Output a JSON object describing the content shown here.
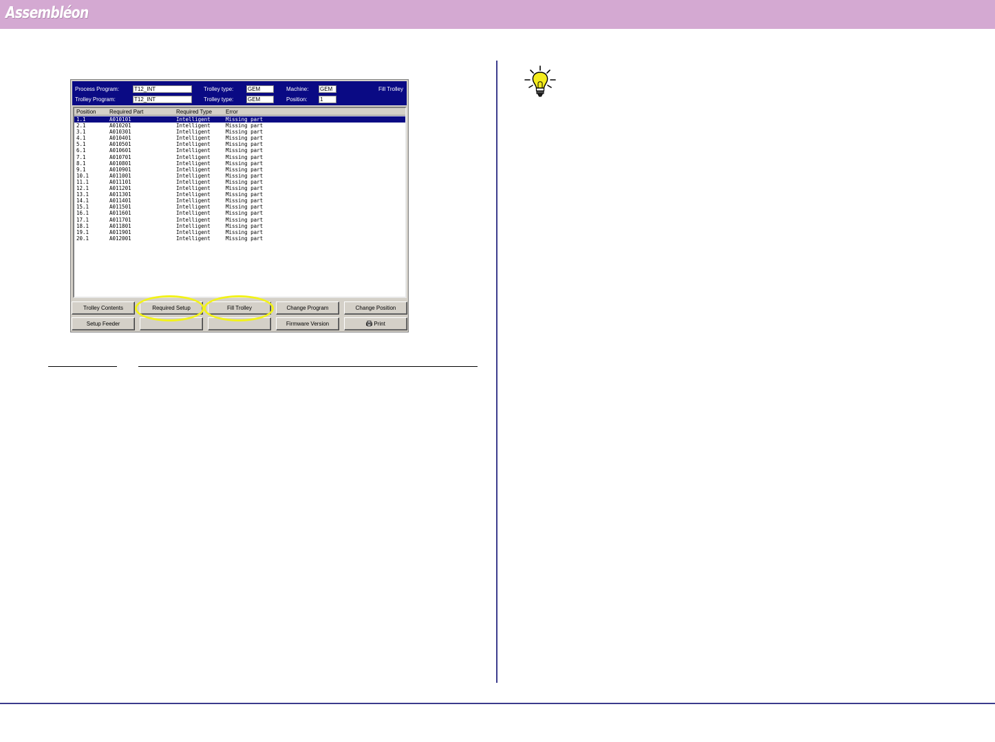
{
  "banner": {
    "logo": "Assembléon"
  },
  "window": {
    "header": {
      "process_program_label": "Process Program:",
      "process_program_value": "T12_INT",
      "trolley_program_label": "Trolley Program:",
      "trolley_program_value": "T12_INT",
      "trolley_type_label_1": "Trolley type:",
      "trolley_type_value_1": "GEM",
      "trolley_type_label_2": "Trolley type:",
      "trolley_type_value_2": "GEM",
      "machine_label": "Machine:",
      "machine_value": "GEM",
      "position_label": "Position:",
      "position_value": "1",
      "title": "Fill Trolley"
    },
    "columns": [
      "Position",
      "Required Part",
      "Required Type",
      "Error"
    ],
    "rows": [
      [
        "1.1",
        "A010101",
        "Intelligent",
        "Missing part"
      ],
      [
        "2.1",
        "A010201",
        "Intelligent",
        "Missing part"
      ],
      [
        "3.1",
        "A010301",
        "Intelligent",
        "Missing part"
      ],
      [
        "4.1",
        "A010401",
        "Intelligent",
        "Missing part"
      ],
      [
        "5.1",
        "A010501",
        "Intelligent",
        "Missing part"
      ],
      [
        "6.1",
        "A010601",
        "Intelligent",
        "Missing part"
      ],
      [
        "7.1",
        "A010701",
        "Intelligent",
        "Missing part"
      ],
      [
        "8.1",
        "A010801",
        "Intelligent",
        "Missing part"
      ],
      [
        "9.1",
        "A010901",
        "Intelligent",
        "Missing part"
      ],
      [
        "10.1",
        "A011001",
        "Intelligent",
        "Missing part"
      ],
      [
        "11.1",
        "A011101",
        "Intelligent",
        "Missing part"
      ],
      [
        "12.1",
        "A011201",
        "Intelligent",
        "Missing part"
      ],
      [
        "13.1",
        "A011301",
        "Intelligent",
        "Missing part"
      ],
      [
        "14.1",
        "A011401",
        "Intelligent",
        "Missing part"
      ],
      [
        "15.1",
        "A011501",
        "Intelligent",
        "Missing part"
      ],
      [
        "16.1",
        "A011601",
        "Intelligent",
        "Missing part"
      ],
      [
        "17.1",
        "A011701",
        "Intelligent",
        "Missing part"
      ],
      [
        "18.1",
        "A011801",
        "Intelligent",
        "Missing part"
      ],
      [
        "19.1",
        "A011901",
        "Intelligent",
        "Missing part"
      ],
      [
        "20.1",
        "A012001",
        "Intelligent",
        "Missing part"
      ]
    ],
    "selected_row": "1.1",
    "buttons": {
      "trolley_contents": "Trolley Contents",
      "required_setup": "Required Setup",
      "fill_trolley": "Fill Trolley",
      "change_program": "Change Program",
      "change_position": "Change Position",
      "setup_feeder": "Setup Feeder",
      "blank_1": "",
      "blank_2": "",
      "firmware_version": "Firmware Version",
      "print": "Print"
    },
    "highlight_color": "#f2f21a"
  },
  "colors": {
    "banner": "#d4a9d2",
    "header": "#0a0a84",
    "rule": "#3a3a8c"
  },
  "icons": {
    "tip": "lightbulb-icon",
    "print": "printer-icon"
  }
}
